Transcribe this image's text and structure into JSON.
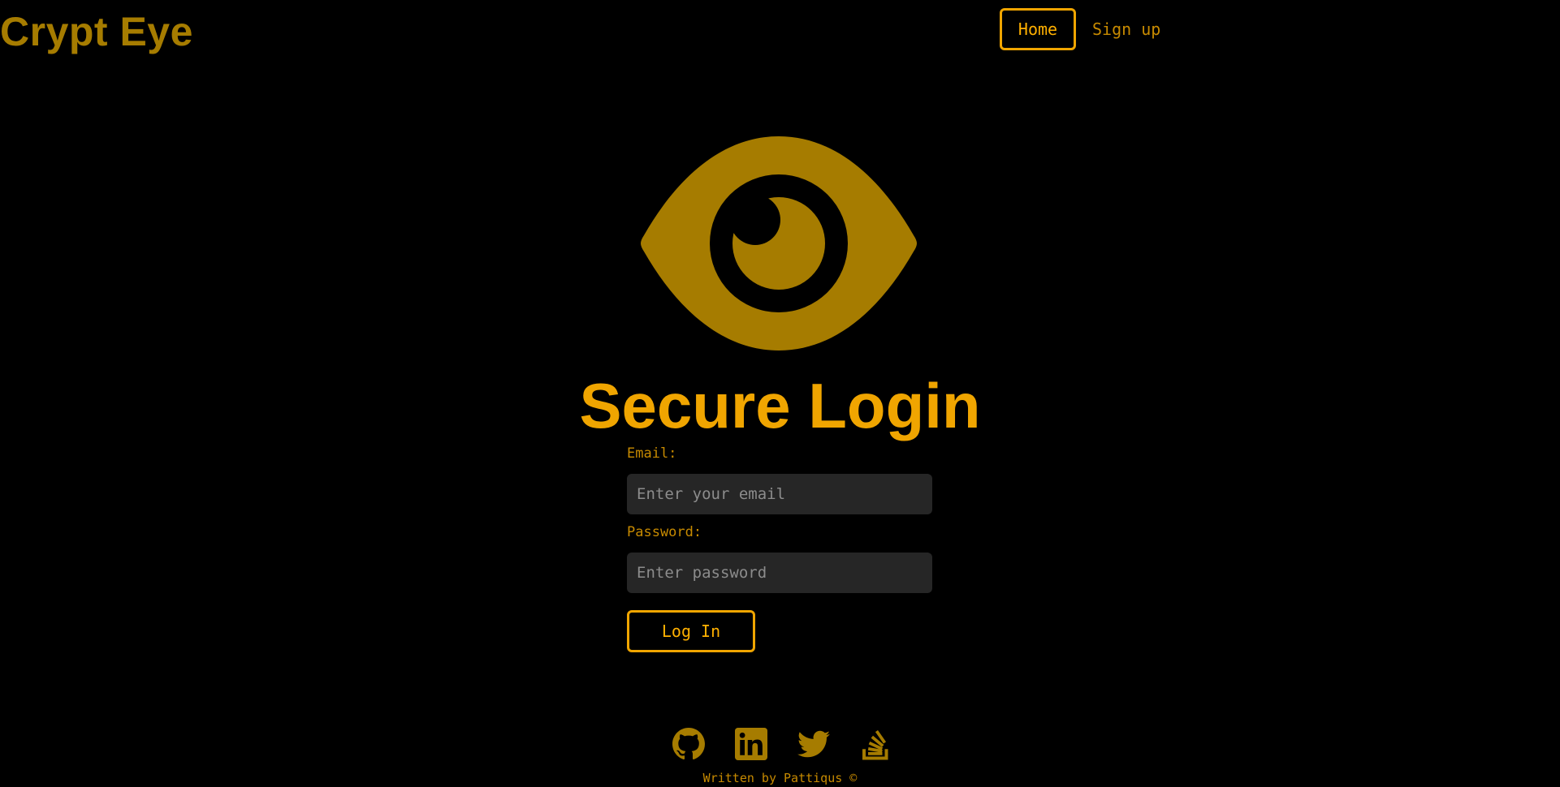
{
  "brand": {
    "name": "Crypt Eye"
  },
  "nav": {
    "home_label": "Home",
    "signup_label": "Sign up"
  },
  "hero": {
    "icon": "eye-icon",
    "title": "Secure Login"
  },
  "form": {
    "email_label": "Email:",
    "email_placeholder": "Enter your email",
    "email_value": "",
    "password_label": "Password:",
    "password_placeholder": "Enter password",
    "password_value": "",
    "submit_label": "Log In"
  },
  "socials": [
    {
      "icon": "github-icon"
    },
    {
      "icon": "linkedin-icon"
    },
    {
      "icon": "twitter-icon"
    },
    {
      "icon": "stackoverflow-icon"
    }
  ],
  "footer": {
    "text": "Written by Pattiqus ©"
  },
  "colors": {
    "background": "#000000",
    "accent": "#f0a500",
    "accent_dim": "#a67c00",
    "input_bg": "#262626"
  }
}
